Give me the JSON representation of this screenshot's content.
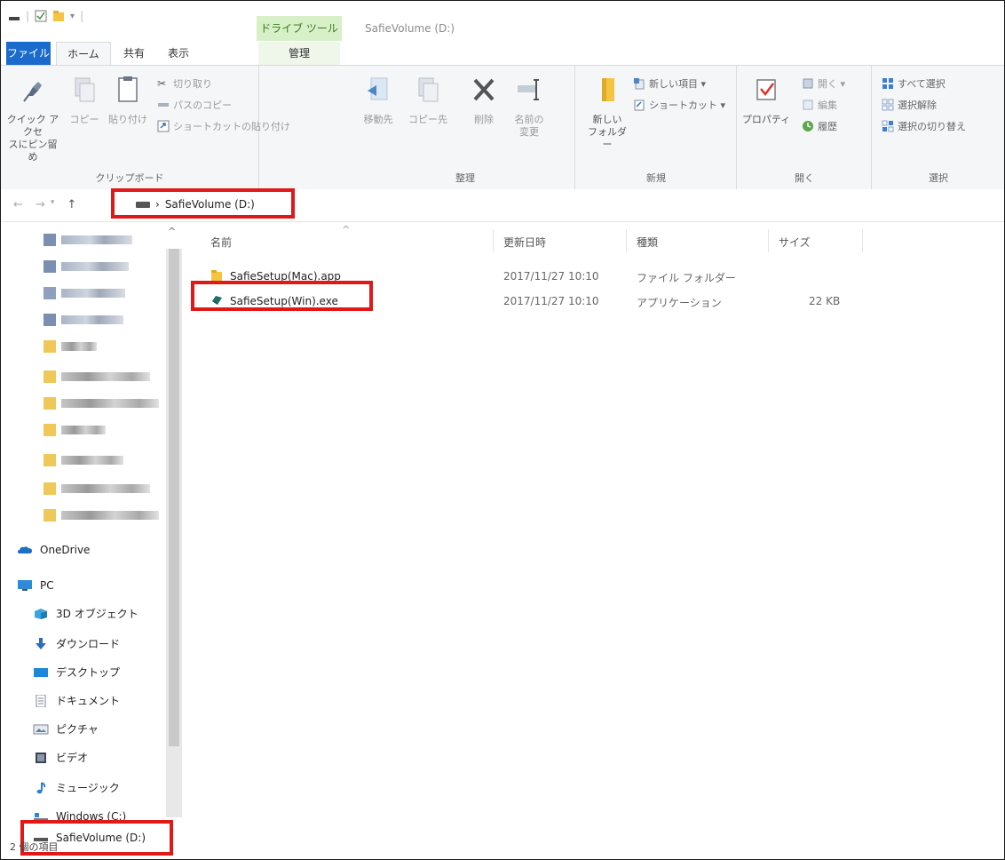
{
  "window": {
    "title": "SafieVolume (D:)",
    "context_tab": "ドライブ ツール"
  },
  "tabs": {
    "file": "ファイル",
    "home": "ホーム",
    "share": "共有",
    "view": "表示",
    "manage": "管理"
  },
  "ribbon": {
    "clipboard": {
      "label": "クリップボード",
      "pin": "クイック アクセスにピン留め",
      "pin_line1": "クイック アクセ",
      "pin_line2": "スにピン留め",
      "copy": "コピー",
      "paste": "貼り付け",
      "cut": "切り取り",
      "copy_path": "パスのコピー",
      "paste_shortcut": "ショートカットの貼り付け"
    },
    "organize": {
      "label": "整理",
      "move_to": "移動先",
      "copy_to": "コピー先",
      "delete": "削除",
      "rename_line1": "名前の",
      "rename_line2": "変更"
    },
    "new": {
      "label": "新規",
      "new_folder_line1": "新しい",
      "new_folder_line2": "フォルダー",
      "new_item": "新しい項目 ▾",
      "easy_access": "ショートカット ▾"
    },
    "open": {
      "label": "開く",
      "properties": "プロパティ",
      "open": "開く ▾",
      "edit": "編集",
      "history": "履歴"
    },
    "select": {
      "label": "選択",
      "select_all": "すべて選択",
      "select_none": "選択解除",
      "invert": "選択の切り替え"
    }
  },
  "address": {
    "path": "SafieVolume (D:)",
    "separator": "›"
  },
  "columns": {
    "name": "名前",
    "date": "更新日時",
    "type": "種類",
    "size": "サイズ"
  },
  "files": [
    {
      "name": "SafieSetup(Mac).app",
      "date": "2017/11/27 10:10",
      "type": "ファイル フォルダー",
      "size": ""
    },
    {
      "name": "SafieSetup(Win).exe",
      "date": "2017/11/27 10:10",
      "type": "アプリケーション",
      "size": "22 KB"
    }
  ],
  "nav": {
    "onedrive": "OneDrive",
    "pc": "PC",
    "items": [
      {
        "label": "3D オブジェクト",
        "icon": "3d-objects-icon"
      },
      {
        "label": "ダウンロード",
        "icon": "download-icon"
      },
      {
        "label": "デスクトップ",
        "icon": "desktop-icon"
      },
      {
        "label": "ドキュメント",
        "icon": "documents-icon"
      },
      {
        "label": "ピクチャ",
        "icon": "pictures-icon"
      },
      {
        "label": "ビデオ",
        "icon": "videos-icon"
      },
      {
        "label": "ミュージック",
        "icon": "music-icon"
      },
      {
        "label": "Windows (C:)",
        "icon": "drive-c-icon"
      },
      {
        "label": "SafieVolume (D:)",
        "icon": "drive-d-icon"
      }
    ]
  },
  "status": {
    "count": "2 個の項目"
  },
  "colors": {
    "file_tab": "#1a6bcc",
    "drive_tools": "#d7f0c8",
    "highlight": "#e01818"
  }
}
